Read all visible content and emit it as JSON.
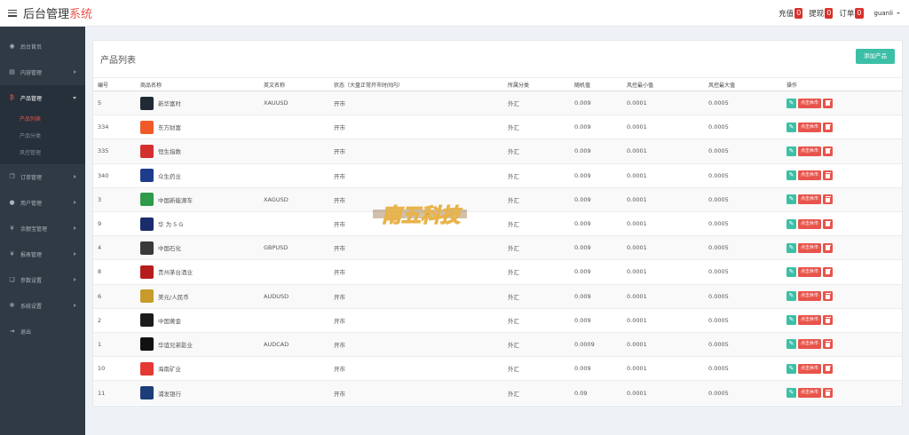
{
  "header": {
    "title_main": "后台管理",
    "title_accent": "系统",
    "nav": [
      {
        "label": "充值",
        "count": "0"
      },
      {
        "label": "提现",
        "count": "0"
      },
      {
        "label": "订单",
        "count": "0"
      }
    ],
    "username": "guanli"
  },
  "sidebar": {
    "items": [
      {
        "label": "后台首页",
        "icon": "dashboard-icon"
      },
      {
        "label": "内容管理",
        "icon": "book-icon"
      },
      {
        "label": "产品管理",
        "icon": "bitcoin-icon"
      },
      {
        "label": "订单管理",
        "icon": "copy-icon"
      },
      {
        "label": "用户管理",
        "icon": "user-icon"
      },
      {
        "label": "余额宝管理",
        "icon": "yen-icon"
      },
      {
        "label": "报表管理",
        "icon": "yen-icon"
      },
      {
        "label": "参数设置",
        "icon": "files-icon"
      },
      {
        "label": "系统设置",
        "icon": "cogs-icon"
      },
      {
        "label": "退出",
        "icon": "logout-icon"
      }
    ],
    "submenu": [
      "产品列表",
      "产品分类",
      "风控管理"
    ],
    "active_sub": 0
  },
  "panel": {
    "title": "产品列表",
    "add_button": "添加产品"
  },
  "table": {
    "headers": [
      "编号",
      "商品名称",
      "英文名称",
      "状态（大盘正常开市时间内）",
      "所属分类",
      "随机值",
      "风控最小值",
      "风控最大值",
      "操作"
    ],
    "close_label": "点击休市",
    "rows": [
      {
        "id": "5",
        "name": "新华富时",
        "en": "XAUUSD",
        "status": "开市",
        "cat": "外汇",
        "rand": "0.009",
        "min": "0.0001",
        "max": "0.0005",
        "logo": "#1f2a35"
      },
      {
        "id": "334",
        "name": "东方财富",
        "en": "",
        "status": "开市",
        "cat": "外汇",
        "rand": "0.009",
        "min": "0.0001",
        "max": "0.0005",
        "logo": "#f05a28"
      },
      {
        "id": "335",
        "name": "恒生指数",
        "en": "",
        "status": "开市",
        "cat": "外汇",
        "rand": "0.009",
        "min": "0.0001",
        "max": "0.0005",
        "logo": "#d32f2f"
      },
      {
        "id": "340",
        "name": "众生药业",
        "en": "",
        "status": "开市",
        "cat": "外汇",
        "rand": "0.009",
        "min": "0.0001",
        "max": "0.0005",
        "logo": "#1e3c8c"
      },
      {
        "id": "3",
        "name": "中国新能源车",
        "en": "XAGUSD",
        "status": "开市",
        "cat": "外汇",
        "rand": "0.009",
        "min": "0.0001",
        "max": "0.0005",
        "logo": "#2e9a4a"
      },
      {
        "id": "9",
        "name": "华 为 5 G",
        "en": "",
        "status": "开市",
        "cat": "外汇",
        "rand": "0.009",
        "min": "0.0001",
        "max": "0.0005",
        "logo": "#1a2c6b"
      },
      {
        "id": "4",
        "name": "中国石化",
        "en": "GBPUSD",
        "status": "开市",
        "cat": "外汇",
        "rand": "0.009",
        "min": "0.0001",
        "max": "0.0005",
        "logo": "#3a3a3a"
      },
      {
        "id": "8",
        "name": "贵州茅台酒业",
        "en": "",
        "status": "开市",
        "cat": "外汇",
        "rand": "0.009",
        "min": "0.0001",
        "max": "0.0005",
        "logo": "#b71c1c"
      },
      {
        "id": "6",
        "name": "美元/人民币",
        "en": "AUDUSD",
        "status": "开市",
        "cat": "外汇",
        "rand": "0.009",
        "min": "0.0001",
        "max": "0.0005",
        "logo": "#c89b2c"
      },
      {
        "id": "2",
        "name": "中国黄金",
        "en": "",
        "status": "开市",
        "cat": "外汇",
        "rand": "0.009",
        "min": "0.0001",
        "max": "0.0005",
        "logo": "#1b1b1b"
      },
      {
        "id": "1",
        "name": "华谊兄弟影业",
        "en": "AUDCAD",
        "status": "开市",
        "cat": "外汇",
        "rand": "0.0009",
        "min": "0.0001",
        "max": "0.0005",
        "logo": "#111111"
      },
      {
        "id": "10",
        "name": "海南矿业",
        "en": "",
        "status": "开市",
        "cat": "外汇",
        "rand": "0.009",
        "min": "0.0001",
        "max": "0.0005",
        "logo": "#e53935"
      },
      {
        "id": "11",
        "name": "浦发银行",
        "en": "",
        "status": "开市",
        "cat": "外汇",
        "rand": "0.09",
        "min": "0.0001",
        "max": "0.0005",
        "logo": "#1c3d7a"
      }
    ]
  },
  "colors": {
    "accent": "#e8544b",
    "teal": "#3cbfa6",
    "sidebar": "#2f3a44"
  }
}
